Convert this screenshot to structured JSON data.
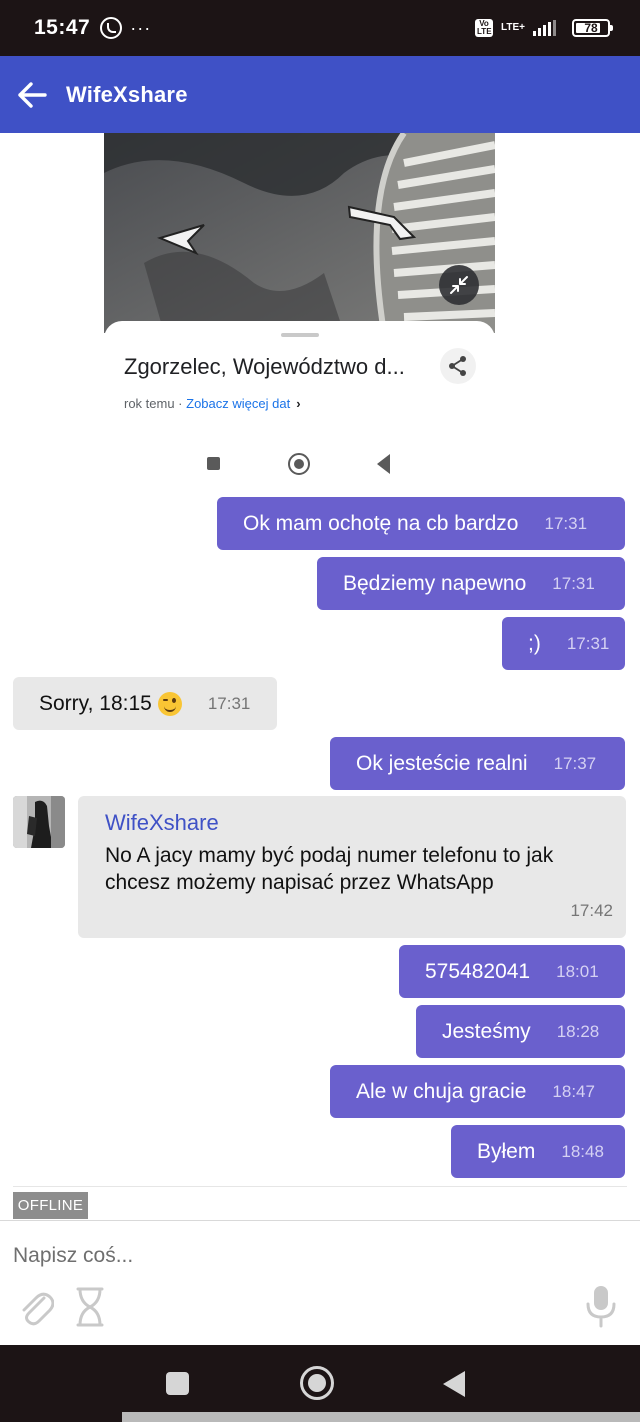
{
  "status_bar": {
    "time": "15:47",
    "dots": "···",
    "volte": "Vo LTE",
    "lte": "LTE+",
    "battery": "78"
  },
  "header": {
    "title": "WifeXshare"
  },
  "shared_image": {
    "place_title": "Zgorzelec, Województwo d...",
    "date_text": "rok temu · ",
    "see_more": "Zobacz więcej dat"
  },
  "messages": [
    {
      "direction": "out",
      "text": "Ok mam ochotę na cb bardzo",
      "time": "17:31"
    },
    {
      "direction": "out",
      "text": "Będziemy napewno",
      "time": "17:31"
    },
    {
      "direction": "out",
      "text": ";)",
      "time": "17:31"
    },
    {
      "direction": "in",
      "text": "Sorry, 18:15",
      "emoji": "winking-face",
      "time": "17:31"
    },
    {
      "direction": "out",
      "text": "Ok jesteście realni",
      "time": "17:37"
    },
    {
      "direction": "in",
      "sender": "WifeXshare",
      "text": "No A jacy mamy być podaj numer telefonu to jak chcesz możemy napisać przez WhatsApp",
      "time": "17:42"
    },
    {
      "direction": "out",
      "text": "575482041",
      "time": "18:01"
    },
    {
      "direction": "out",
      "text": "Jesteśmy",
      "time": "18:28"
    },
    {
      "direction": "out",
      "text": "Ale w chuja gracie",
      "time": "18:47"
    },
    {
      "direction": "out",
      "text": "Byłem",
      "time": "18:48"
    }
  ],
  "status": {
    "offline": "OFFLINE"
  },
  "composer": {
    "placeholder": "Napisz coś..."
  },
  "colors": {
    "app_bar": "#3f51c6",
    "outgoing_bubble": "#6a60cd",
    "incoming_bubble": "#e8e8e8",
    "sender_name": "#3f51c6",
    "offline_badge": "#8d8d8d"
  },
  "icons": [
    "whatsapp-icon",
    "back-arrow-icon",
    "share-icon",
    "minimize-icon",
    "attach-icon",
    "timer-icon",
    "mic-icon"
  ]
}
